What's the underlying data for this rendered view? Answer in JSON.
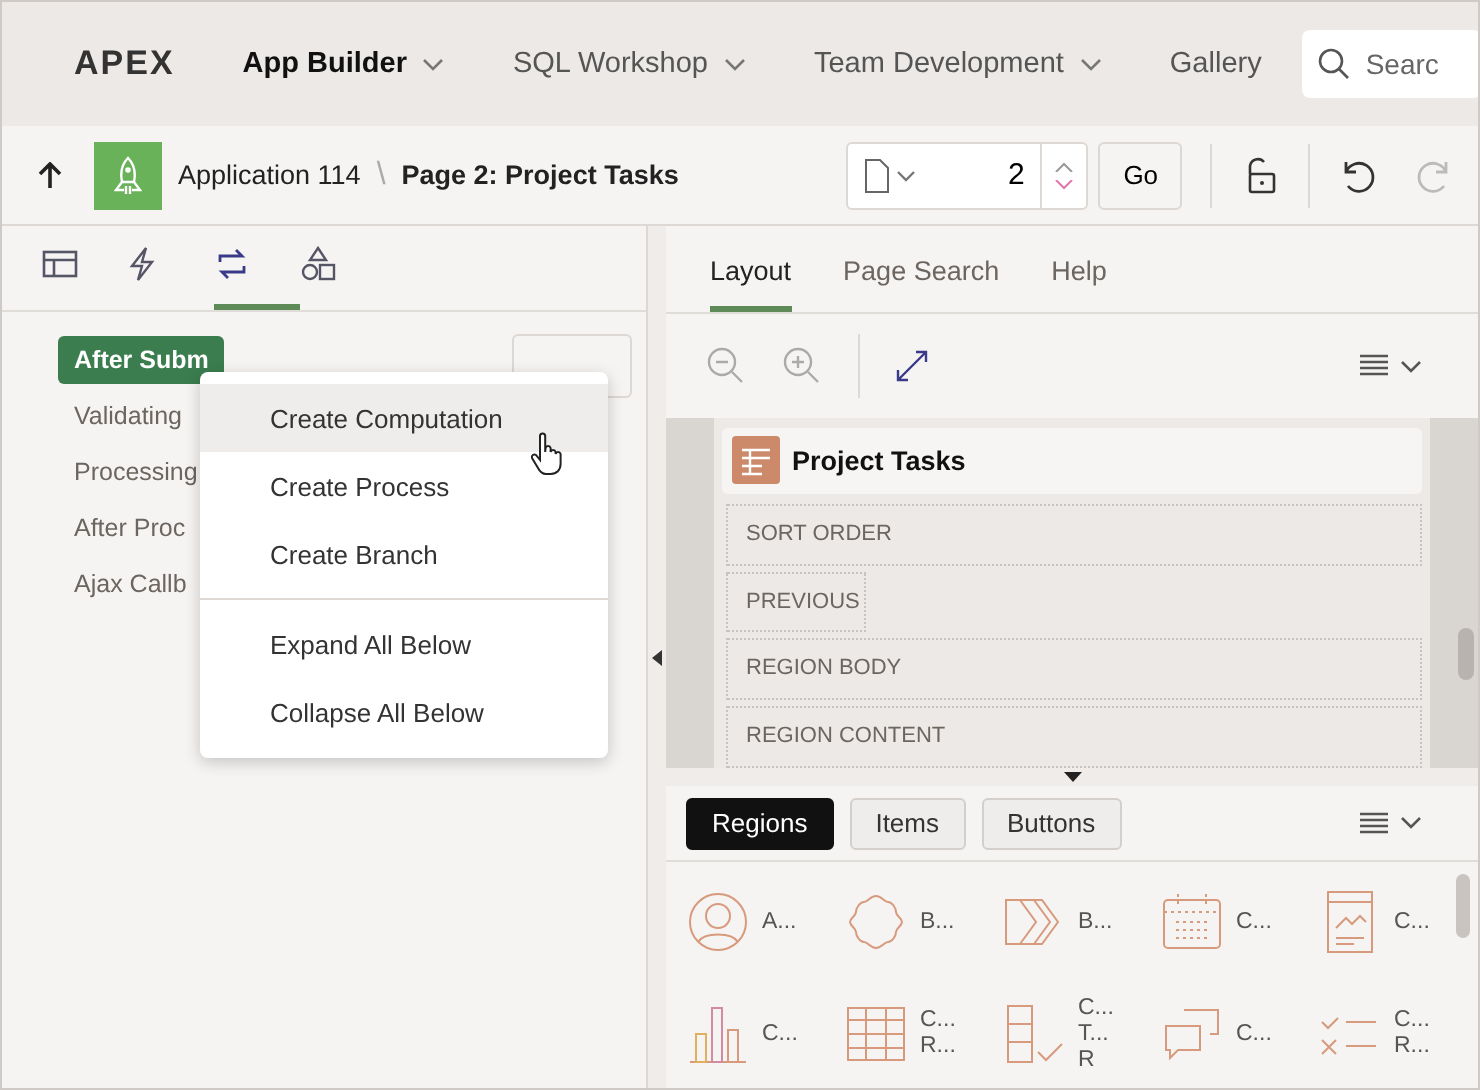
{
  "header": {
    "logo_text": "APEX",
    "nav": [
      {
        "label": "App Builder",
        "selected": true,
        "has_menu": true
      },
      {
        "label": "SQL Workshop",
        "selected": false,
        "has_menu": true
      },
      {
        "label": "Team Development",
        "selected": false,
        "has_menu": true
      },
      {
        "label": "Gallery",
        "selected": false,
        "has_menu": false
      }
    ],
    "search": {
      "placeholder": "Searc"
    }
  },
  "toolbar": {
    "application": "Application 114",
    "separator": "\\",
    "page": "Page 2: Project Tasks",
    "page_number": "2",
    "go": "Go"
  },
  "left_tabs": [
    {
      "kind": "rendering",
      "selected": false
    },
    {
      "kind": "dynamic",
      "selected": false
    },
    {
      "kind": "processing",
      "selected": true
    },
    {
      "kind": "shared",
      "selected": false
    }
  ],
  "tree": [
    {
      "label": "After Subm",
      "selected": true
    },
    {
      "label": "Validating",
      "selected": false
    },
    {
      "label": "Processing",
      "selected": false
    },
    {
      "label": "After Proc",
      "selected": false
    },
    {
      "label": "Ajax Callb",
      "selected": false
    }
  ],
  "context_menu": [
    [
      {
        "label": "Create Computation",
        "highlighted": true
      },
      {
        "label": "Create Process",
        "highlighted": false
      },
      {
        "label": "Create Branch",
        "highlighted": false
      }
    ],
    [
      {
        "label": "Expand All Below",
        "highlighted": false
      },
      {
        "label": "Collapse All Below",
        "highlighted": false
      }
    ]
  ],
  "right_tabs": [
    {
      "label": "Layout",
      "selected": true
    },
    {
      "label": "Page Search",
      "selected": false
    },
    {
      "label": "Help",
      "selected": false
    }
  ],
  "layout": {
    "region_title": "Project Tasks",
    "slots": [
      {
        "label": "SORT ORDER",
        "full": true
      },
      {
        "label": "PREVIOUS",
        "full": false
      },
      {
        "label": "REGION BODY",
        "full": true
      },
      {
        "label": "REGION CONTENT",
        "full": true
      }
    ]
  },
  "gallery_tabs": [
    {
      "label": "Regions",
      "selected": true
    },
    {
      "label": "Items",
      "selected": false
    },
    {
      "label": "Buttons",
      "selected": false
    }
  ],
  "gallery": [
    {
      "kind": "avatar",
      "lines": [
        "A..."
      ]
    },
    {
      "kind": "badge",
      "lines": [
        "B..."
      ]
    },
    {
      "kind": "breadcrumb",
      "lines": [
        "B..."
      ]
    },
    {
      "kind": "calendar",
      "lines": [
        "C..."
      ]
    },
    {
      "kind": "card",
      "lines": [
        "C..."
      ]
    },
    {
      "kind": "chart",
      "lines": [
        "C..."
      ]
    },
    {
      "kind": "grid",
      "lines": [
        "C...",
        "R..."
      ]
    },
    {
      "kind": "checktable",
      "lines": [
        "C...",
        "T...",
        "R"
      ]
    },
    {
      "kind": "comments",
      "lines": [
        "C..."
      ]
    },
    {
      "kind": "checklist",
      "lines": [
        "C...",
        "R..."
      ]
    }
  ]
}
